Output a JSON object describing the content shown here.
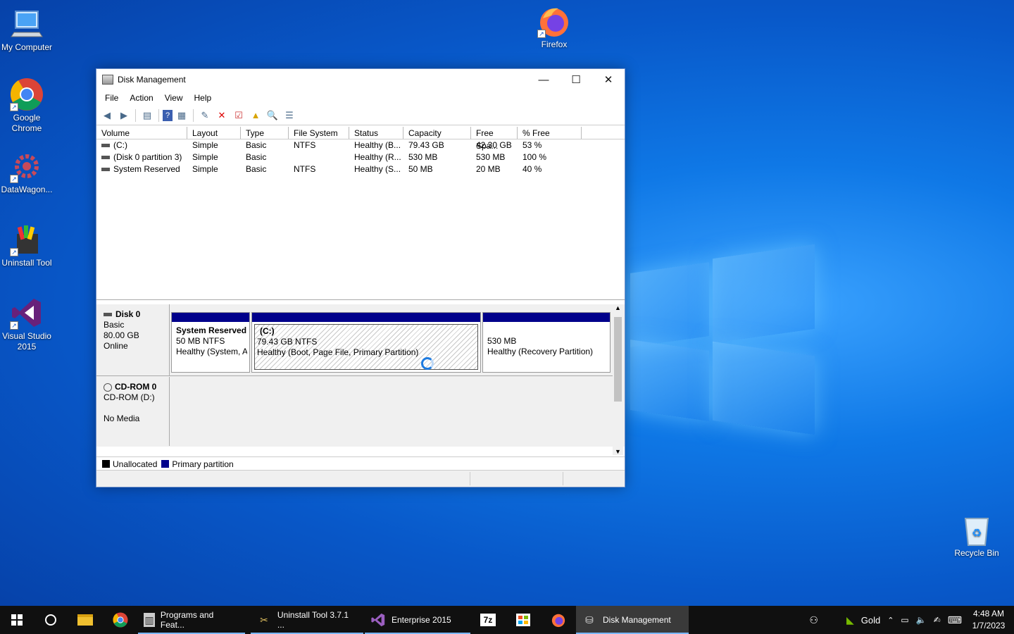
{
  "desktop": {
    "icons": [
      {
        "label": "My Computer",
        "icon": "my-computer-icon"
      },
      {
        "label": "Google Chrome",
        "icon": "chrome-icon"
      },
      {
        "label": "DataWagon...",
        "icon": "datawagon-icon"
      },
      {
        "label": "Uninstall Tool",
        "icon": "uninstall-tool-icon"
      },
      {
        "label": "Visual Studio 2015",
        "icon": "visual-studio-icon"
      },
      {
        "label": "Firefox",
        "icon": "firefox-icon"
      },
      {
        "label": "Recycle Bin",
        "icon": "recycle-bin-icon"
      }
    ]
  },
  "window": {
    "title": "Disk Management",
    "controls": {
      "minimize": "—",
      "maximize": "☐",
      "close": "✕"
    },
    "menu": [
      "File",
      "Action",
      "View",
      "Help"
    ],
    "volume_list": {
      "columns": [
        "Volume",
        "Layout",
        "Type",
        "File System",
        "Status",
        "Capacity",
        "Free Spa...",
        "% Free"
      ],
      "rows": [
        [
          "(C:)",
          "Simple",
          "Basic",
          "NTFS",
          "Healthy (B...",
          "79.43 GB",
          "42.30 GB",
          "53 %"
        ],
        [
          "(Disk 0 partition 3)",
          "Simple",
          "Basic",
          "",
          "Healthy (R...",
          "530 MB",
          "530 MB",
          "100 %"
        ],
        [
          "System Reserved",
          "Simple",
          "Basic",
          "NTFS",
          "Healthy (S...",
          "50 MB",
          "20 MB",
          "40 %"
        ]
      ]
    },
    "disk0": {
      "name": "Disk 0",
      "type": "Basic",
      "size": "80.00 GB",
      "state": "Online",
      "partitions": [
        {
          "name": "System Reserved",
          "size": "50 MB NTFS",
          "status": "Healthy (System, A"
        },
        {
          "name": "(C:)",
          "size": "79.43 GB NTFS",
          "status": "Healthy (Boot, Page File, Primary Partition)"
        },
        {
          "name": "",
          "size": "530 MB",
          "status": "Healthy (Recovery Partition)"
        }
      ]
    },
    "cdrom": {
      "name": "CD-ROM 0",
      "drive": "CD-ROM (D:)",
      "media": "No Media"
    },
    "legend": {
      "unallocated": "Unallocated",
      "primary": "Primary partition",
      "unallocated_color": "#000000",
      "primary_color": "#00008b"
    }
  },
  "taskbar": {
    "apps": [
      {
        "label": "Programs and Feat...",
        "icon": "programs-features-icon"
      },
      {
        "label": "Uninstall Tool 3.7.1 ...",
        "icon": "uninstall-tool-icon"
      },
      {
        "label": "Enterprise 2015",
        "icon": "visual-studio-icon"
      },
      {
        "label": "Disk Management",
        "icon": "disk-management-icon"
      }
    ],
    "tray_label": "Gold",
    "time": "4:48 AM",
    "date": "1/7/2023"
  }
}
